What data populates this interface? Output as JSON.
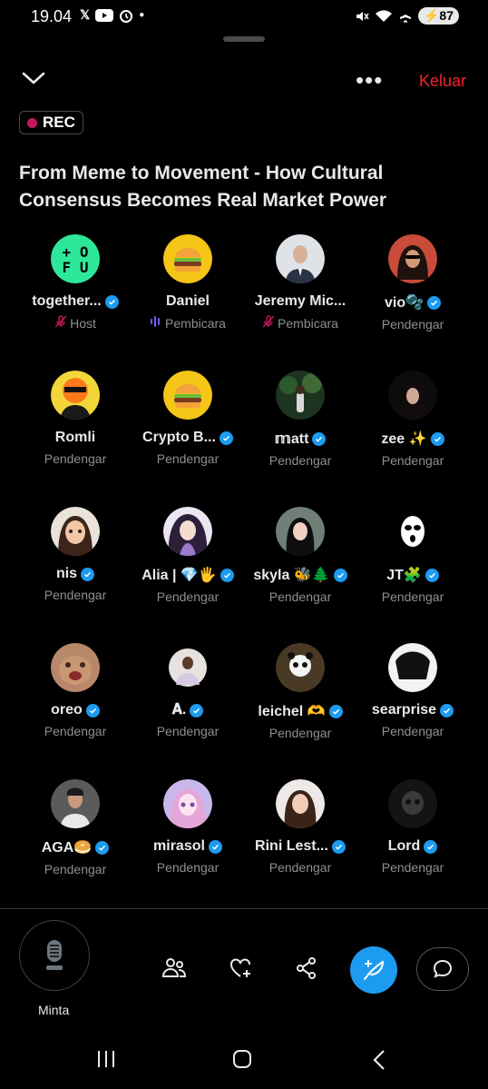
{
  "status_bar": {
    "time": "19.04",
    "battery": "87",
    "left_icons": [
      "x-logo-icon",
      "youtube-icon",
      "alarm-icon",
      "dot-icon"
    ],
    "right_icons": [
      "mute-icon",
      "wifi-icon",
      "airplane-icon",
      "battery-icon"
    ]
  },
  "header": {
    "leave_label": "Keluar",
    "more_label": "•••"
  },
  "rec_label": "REC",
  "space_title": "From Meme to Movement - How Cultural Consensus Becomes Real Market Power",
  "participants": [
    {
      "name": "together...",
      "verified": true,
      "role": "Host",
      "role_icon": "mic-off",
      "avatar": "tofu-logo"
    },
    {
      "name": "Daniel",
      "verified": false,
      "role": "Pembicara",
      "role_icon": "speaking",
      "avatar": "burger"
    },
    {
      "name": "Jeremy Mic...",
      "verified": false,
      "role": "Pembicara",
      "role_icon": "mic-off",
      "avatar": "photo-man"
    },
    {
      "name": "vio🫧",
      "verified": true,
      "role": "Pendengar",
      "role_icon": "",
      "avatar": "photo-woman"
    },
    {
      "name": "Romli",
      "verified": false,
      "role": "Pendengar",
      "role_icon": "",
      "avatar": "orange-mask"
    },
    {
      "name": "Crypto B...",
      "verified": true,
      "role": "Pendengar",
      "role_icon": "",
      "avatar": "burger"
    },
    {
      "name": "𝕞att",
      "verified": true,
      "role": "Pendengar",
      "role_icon": "",
      "avatar": "photo-forest"
    },
    {
      "name": "zee ✨",
      "verified": true,
      "role": "Pendengar",
      "role_icon": "",
      "avatar": "photo-dark"
    },
    {
      "name": "nis",
      "verified": true,
      "role": "Pendengar",
      "role_icon": "",
      "avatar": "anime-girl"
    },
    {
      "name": "Alia | 💎🖐",
      "verified": true,
      "role": "Pendengar",
      "role_icon": "",
      "avatar": "anime-curly"
    },
    {
      "name": "skyla 🐝🌲",
      "verified": true,
      "role": "Pendengar",
      "role_icon": "",
      "avatar": "photo-girl"
    },
    {
      "name": "JT🧩",
      "verified": true,
      "role": "Pendengar",
      "role_icon": "",
      "avatar": "skimask"
    },
    {
      "name": "oreo",
      "verified": true,
      "role": "Pendengar",
      "role_icon": "",
      "avatar": "cat"
    },
    {
      "name": "𝐀.",
      "verified": true,
      "role": "Pendengar",
      "role_icon": "",
      "avatar": "photo-small"
    },
    {
      "name": "leichel 🫶",
      "verified": true,
      "role": "Pendengar",
      "role_icon": "",
      "avatar": "panda"
    },
    {
      "name": "searprise",
      "verified": true,
      "role": "Pendengar",
      "role_icon": "",
      "avatar": "manga"
    },
    {
      "name": "AGA🥯",
      "verified": true,
      "role": "Pendengar",
      "role_icon": "",
      "avatar": "photo-man2"
    },
    {
      "name": "mirasol",
      "verified": true,
      "role": "Pendengar",
      "role_icon": "",
      "avatar": "anime-pink"
    },
    {
      "name": "Rini Lest...",
      "verified": true,
      "role": "Pendengar",
      "role_icon": "",
      "avatar": "photo-woman2"
    },
    {
      "name": "Lord",
      "verified": true,
      "role": "Pendengar",
      "role_icon": "",
      "avatar": "skull"
    }
  ],
  "toolbar": {
    "request_label": "Minta"
  },
  "colors": {
    "accent": "#1d9bf0",
    "leave": "#f4212e",
    "rec_dot": "#c4175c",
    "mic_off": "#c4175c",
    "speaking": "#7856ff"
  }
}
